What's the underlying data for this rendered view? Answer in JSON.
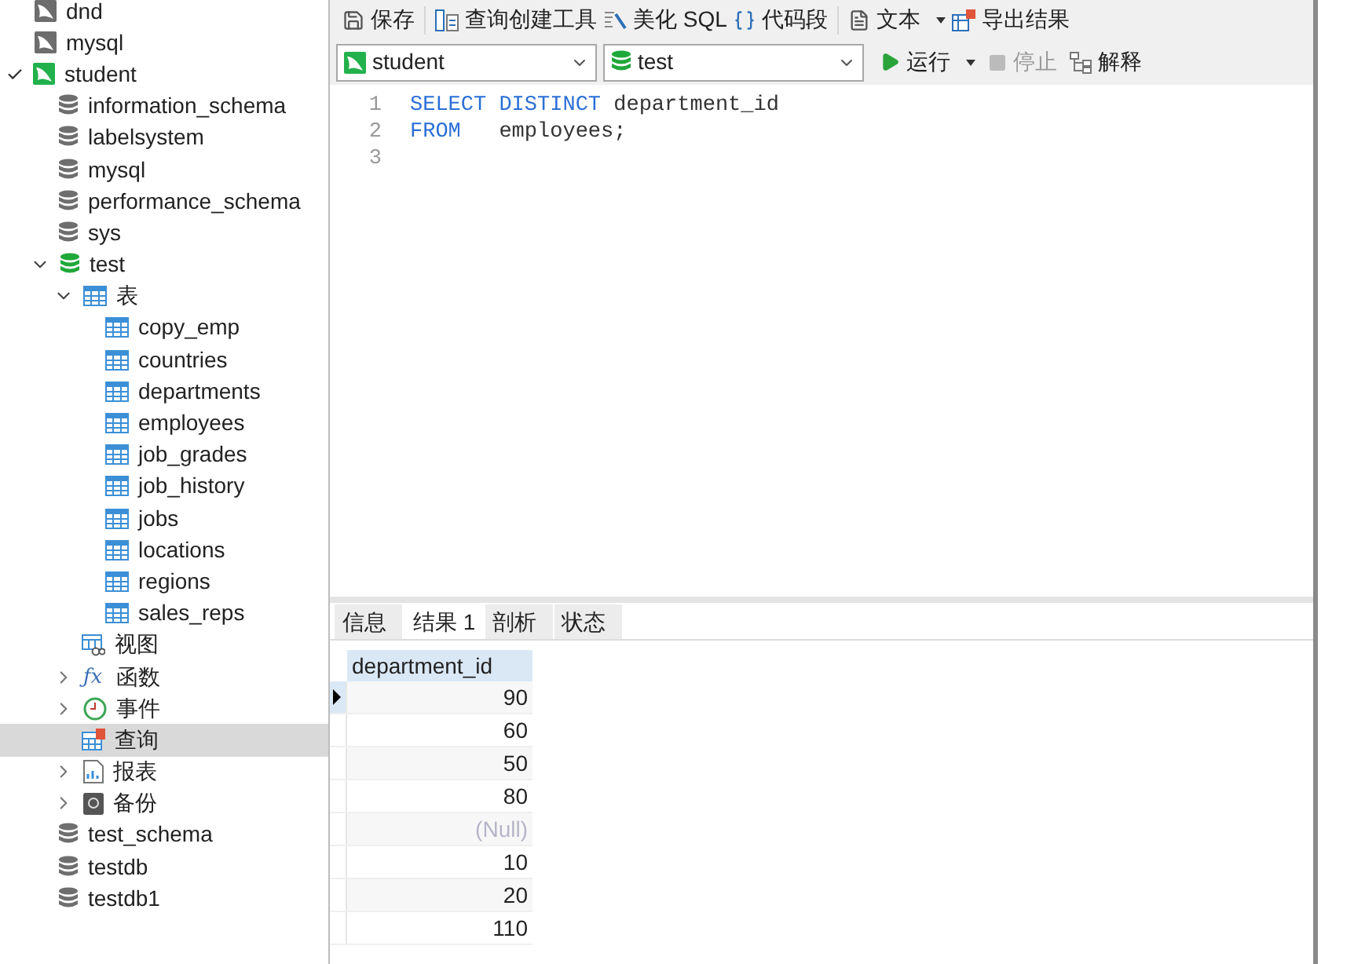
{
  "sidebar": {
    "items": [
      {
        "kind": "connection",
        "label": "dnd",
        "open": false,
        "selected": false
      },
      {
        "kind": "connection",
        "label": "mysql",
        "open": false,
        "selected": false
      },
      {
        "kind": "connection",
        "label": "student",
        "open": true,
        "selected": false,
        "expanded": true,
        "children": [
          {
            "kind": "database",
            "label": "information_schema",
            "open": false,
            "selected": false
          },
          {
            "kind": "database",
            "label": "labelsystem",
            "open": false,
            "selected": false
          },
          {
            "kind": "database",
            "label": "mysql",
            "open": false,
            "selected": false
          },
          {
            "kind": "database",
            "label": "performance_schema",
            "open": false,
            "selected": false
          },
          {
            "kind": "database",
            "label": "sys",
            "open": false,
            "selected": false
          },
          {
            "kind": "database",
            "label": "test",
            "open": true,
            "selected": false,
            "expanded": true,
            "children": [
              {
                "kind": "tables",
                "label": "表",
                "selected": false,
                "expanded": true,
                "children": [
                  {
                    "kind": "table",
                    "label": "copy_emp",
                    "selected": false
                  },
                  {
                    "kind": "table",
                    "label": "countries",
                    "selected": false
                  },
                  {
                    "kind": "table",
                    "label": "departments",
                    "selected": false
                  },
                  {
                    "kind": "table",
                    "label": "employees",
                    "selected": false
                  },
                  {
                    "kind": "table",
                    "label": "job_grades",
                    "selected": false
                  },
                  {
                    "kind": "table",
                    "label": "job_history",
                    "selected": false
                  },
                  {
                    "kind": "table",
                    "label": "jobs",
                    "selected": false
                  },
                  {
                    "kind": "table",
                    "label": "locations",
                    "selected": false
                  },
                  {
                    "kind": "table",
                    "label": "regions",
                    "selected": false
                  },
                  {
                    "kind": "table",
                    "label": "sales_reps",
                    "selected": false
                  }
                ]
              },
              {
                "kind": "views",
                "label": "视图",
                "selected": false
              },
              {
                "kind": "functions",
                "icon": "ƒx",
                "label": "函数",
                "selected": false,
                "expanded": false
              },
              {
                "kind": "events",
                "label": "事件",
                "selected": false,
                "expanded": false
              },
              {
                "kind": "queries",
                "label": "查询",
                "selected": true
              },
              {
                "kind": "reports",
                "label": "报表",
                "selected": false,
                "expanded": false
              },
              {
                "kind": "backups",
                "label": "备份",
                "selected": false,
                "expanded": false
              }
            ]
          },
          {
            "kind": "database",
            "label": "test_schema",
            "open": false,
            "selected": false
          },
          {
            "kind": "database",
            "label": "testdb",
            "open": false,
            "selected": false
          },
          {
            "kind": "database",
            "label": "testdb1",
            "open": false,
            "selected": false
          }
        ]
      }
    ]
  },
  "toolbar": [
    {
      "kind": "save",
      "label": "保存",
      "dropdown": false
    },
    {
      "kind": "builder",
      "label": "查询创建工具",
      "dropdown": false
    },
    {
      "kind": "beautify",
      "label": "美化 SQL",
      "dropdown": false
    },
    {
      "kind": "snippet",
      "label": "代码段",
      "dropdown": false
    },
    {
      "kind": "text",
      "label": "文本",
      "dropdown": true
    },
    {
      "kind": "export",
      "label": "导出结果",
      "dropdown": false
    }
  ],
  "selectors": [
    {
      "kind": "connection",
      "value": "student"
    },
    {
      "kind": "database",
      "value": "test"
    }
  ],
  "actions": [
    {
      "kind": "run",
      "label": "运行",
      "dropdown": true,
      "disabled": false
    },
    {
      "kind": "stop",
      "label": "停止",
      "dropdown": false,
      "disabled": true
    },
    {
      "kind": "explain",
      "label": "解释",
      "dropdown": false,
      "disabled": false
    }
  ],
  "editor": {
    "lines": [
      {
        "number": "1",
        "tokens": [
          {
            "kind": "keyword",
            "text": "SELECT DISTINCT"
          },
          {
            "kind": "plain",
            "text": " department_id"
          }
        ]
      },
      {
        "number": "2",
        "tokens": [
          {
            "kind": "keyword",
            "text": "FROM"
          },
          {
            "kind": "plain",
            "text": "   employees;"
          }
        ]
      },
      {
        "number": "3"
      }
    ]
  },
  "result_tabs": [
    {
      "label": "信息",
      "selected": false
    },
    {
      "label": "结果 1",
      "selected": true
    },
    {
      "label": "剖析",
      "selected": false
    },
    {
      "label": "状态",
      "selected": false
    }
  ],
  "table": {
    "columns": [
      "department_id"
    ],
    "rows": [
      {
        "value": "90",
        "is_null": false,
        "selected": true
      },
      {
        "value": "60",
        "is_null": false,
        "selected": false
      },
      {
        "value": "50",
        "is_null": false,
        "selected": false
      },
      {
        "value": "80",
        "is_null": false,
        "selected": false
      },
      {
        "value": "(Null)",
        "is_null": true,
        "selected": false
      },
      {
        "value": "10",
        "is_null": false,
        "selected": false
      },
      {
        "value": "20",
        "is_null": false,
        "selected": false
      },
      {
        "value": "110",
        "is_null": false,
        "selected": false
      }
    ]
  }
}
